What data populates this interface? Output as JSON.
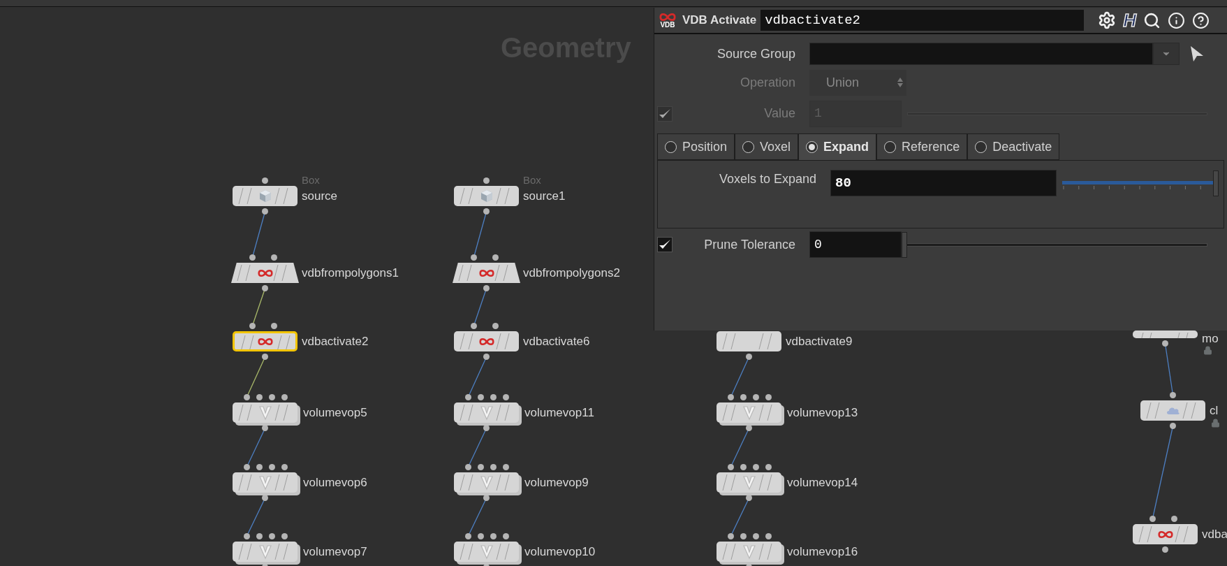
{
  "network": {
    "title": "Geometry",
    "columns": [
      {
        "nodes": [
          {
            "kind": "box",
            "type_label": "Box",
            "name": "source",
            "selected": false,
            "locked": false
          },
          {
            "kind": "vdb_from_polygons",
            "name": "vdbfrompolygons1",
            "selected": false,
            "locked": false,
            "wire_highlighted": false
          },
          {
            "kind": "vdb",
            "name": "vdbactivate2",
            "selected": true,
            "locked": false,
            "wire_highlighted": true
          },
          {
            "kind": "volumevop",
            "name": "volumevop5",
            "selected": false,
            "locked": false,
            "wire_highlighted": true
          },
          {
            "kind": "volumevop",
            "name": "volumevop6",
            "selected": false,
            "locked": false,
            "wire_highlighted": false
          },
          {
            "kind": "volumevop",
            "name": "volumevop7",
            "selected": false,
            "locked": false,
            "wire_highlighted": false
          }
        ]
      },
      {
        "nodes": [
          {
            "kind": "box",
            "type_label": "Box",
            "name": "source1",
            "selected": false,
            "locked": false
          },
          {
            "kind": "vdb_from_polygons",
            "name": "vdbfrompolygons2",
            "selected": false,
            "locked": false,
            "wire_highlighted": false
          },
          {
            "kind": "vdb",
            "name": "vdbactivate6",
            "selected": false,
            "locked": false,
            "wire_highlighted": false
          },
          {
            "kind": "volumevop",
            "name": "volumevop11",
            "selected": false,
            "locked": false,
            "wire_highlighted": false
          },
          {
            "kind": "volumevop",
            "name": "volumevop9",
            "selected": false,
            "locked": false,
            "wire_highlighted": false
          },
          {
            "kind": "volumevop",
            "name": "volumevop10",
            "selected": false,
            "locked": false,
            "wire_highlighted": false
          }
        ]
      },
      {
        "nodes": [
          {
            "kind": "vdb",
            "name": "vdbactivate9",
            "selected": false,
            "locked": false
          },
          {
            "kind": "volumevop",
            "name": "volumevop13",
            "selected": false,
            "locked": false,
            "wire_highlighted": false
          },
          {
            "kind": "volumevop",
            "name": "volumevop14",
            "selected": false,
            "locked": false,
            "wire_highlighted": false
          },
          {
            "kind": "volumevop",
            "name": "volumevop16",
            "selected": false,
            "locked": false,
            "wire_highlighted": false
          }
        ]
      },
      {
        "nodes": [
          {
            "kind": "flame",
            "name": "mo",
            "selected": false,
            "locked": true
          },
          {
            "kind": "cloud",
            "name": "cl",
            "selected": false,
            "locked": true,
            "wire_highlighted": false
          },
          {
            "kind": "vdb",
            "name": "vdba",
            "selected": false,
            "locked": false,
            "wire_highlighted": false
          }
        ]
      }
    ]
  },
  "parameters": {
    "logo_text": "VDB",
    "node_type": "VDB Activate",
    "node_name": "vdbactivate2",
    "houdini_button": "H",
    "source_group": {
      "label": "Source Group"
    },
    "operation": {
      "label": "Operation",
      "value": "Union",
      "disabled": true
    },
    "value": {
      "label": "Value",
      "value": "1",
      "disabled": true,
      "checked": true
    },
    "tabs": [
      {
        "label": "Position",
        "selected": false
      },
      {
        "label": "Voxel",
        "selected": false
      },
      {
        "label": "Expand",
        "selected": true
      },
      {
        "label": "Reference",
        "selected": false
      },
      {
        "label": "Deactivate",
        "selected": false
      }
    ],
    "voxels_to_expand": {
      "label": "Voxels to Expand",
      "value": "80",
      "level": 1
    },
    "prune_tolerance": {
      "label": "Prune Tolerance",
      "value": "0",
      "checked": true,
      "level": 0
    }
  }
}
